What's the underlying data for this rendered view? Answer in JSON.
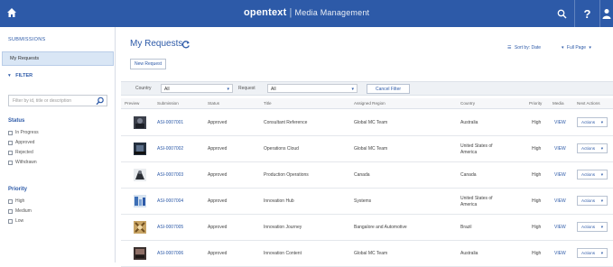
{
  "header": {
    "brand": "opentext",
    "divider": "|",
    "app_name": "Media Management",
    "help_label": "?",
    "icons": {
      "home": "home-icon",
      "search": "search-icon",
      "user": "user-icon"
    }
  },
  "sidebar": {
    "section_title": "SUBMISSIONS",
    "my_requests_label": "My Requests",
    "filter_label": "FILTER",
    "filter_search_placeholder": "Filter by id, title or description",
    "status_group": "Status",
    "status_options": [
      "In Progress",
      "Approved",
      "Rejected",
      "Withdrawn"
    ],
    "priority_group": "Priority",
    "priority_options": [
      "High",
      "Medium",
      "Low"
    ]
  },
  "main": {
    "title": "My Requests",
    "sort_label": "Sort by: Date",
    "view_label": "Full Page",
    "new_request_label": "New Request",
    "toolbar": {
      "country_label": "Country",
      "country_value": "All",
      "request_label": "Request",
      "request_value": "All",
      "cancel_label": "Cancel Filter"
    },
    "columns": [
      "Preview",
      "Submission",
      "Status",
      "Title",
      "Assigned Region",
      "Country",
      "Priority",
      "Media",
      "Next Actions"
    ],
    "rows": [
      {
        "id": "ASI-0007001",
        "status": "Approved",
        "title": "Consultant Reference",
        "region": "Global MC Team",
        "country": "Australia",
        "priority": "High",
        "media": "VIEW",
        "action": "Actions"
      },
      {
        "id": "ASI-0007002",
        "status": "Approved",
        "title": "Operations Cloud",
        "region": "Global MC Team",
        "country": "United States of America",
        "priority": "High",
        "media": "VIEW",
        "action": "Actions"
      },
      {
        "id": "ASI-0007003",
        "status": "Approved",
        "title": "Production Operations",
        "region": "Canada",
        "country": "Canada",
        "priority": "High",
        "media": "VIEW",
        "action": "Actions"
      },
      {
        "id": "ASI-0007004",
        "status": "Approved",
        "title": "Innovation Hub",
        "region": "Systems",
        "country": "United States of America",
        "priority": "High",
        "media": "VIEW",
        "action": "Actions"
      },
      {
        "id": "ASI-0007005",
        "status": "Approved",
        "title": "Innovation Journey",
        "region": "Bangalore and Automotive",
        "country": "Brazil",
        "priority": "High",
        "media": "VIEW",
        "action": "Actions"
      },
      {
        "id": "ASI-0007006",
        "status": "Approved",
        "title": "Innovation Content",
        "region": "Global MC Team",
        "country": "Australia",
        "priority": "High",
        "media": "VIEW",
        "action": "Actions"
      }
    ]
  },
  "colors": {
    "header_bg": "#2d5aa8",
    "accent": "#2d5aa8",
    "selected_bg": "#d9e6f5",
    "toolbar_bg": "#eef1f5"
  }
}
